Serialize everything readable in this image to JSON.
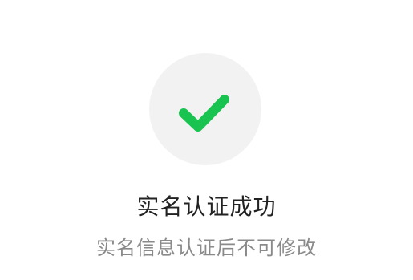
{
  "status": {
    "icon": "check-icon",
    "icon_color": "#19c34f",
    "circle_color": "#f2f2f2",
    "title": "实名认证成功",
    "subtitle": "实名信息认证后不可修改"
  }
}
